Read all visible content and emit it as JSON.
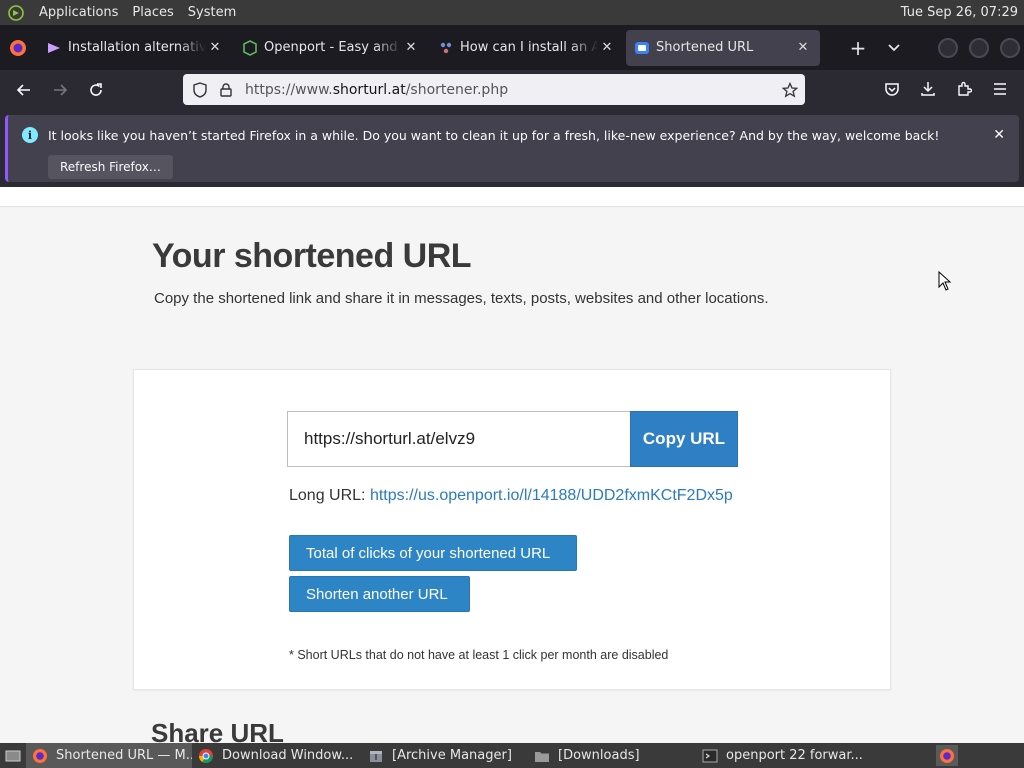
{
  "top_panel": {
    "menus": [
      "Applications",
      "Places",
      "System"
    ],
    "clock": "Tue Sep 26, 07:29"
  },
  "tabs": [
    {
      "title": "Installation alternatives",
      "active": false
    },
    {
      "title": "Openport - Easy and se",
      "active": false
    },
    {
      "title": "How can I install an Arc",
      "active": false
    },
    {
      "title": "Shortened URL",
      "active": true
    }
  ],
  "navbar": {
    "url_prefix": "https://www.",
    "url_host": "shorturl.at",
    "url_path": "/shortener.php"
  },
  "notification": {
    "message": "It looks like you haven’t started Firefox in a while. Do you want to clean it up for a fresh, like-new experience? And by the way, welcome back!",
    "refresh_label": "Refresh Firefox…"
  },
  "page": {
    "title": "Your shortened URL",
    "subtitle": "Copy the shortened link and share it in messages, texts, posts, websites and other locations.",
    "short_url": "https://shorturl.at/elvz9",
    "copy_label": "Copy URL",
    "long_url_label": "Long URL:",
    "long_url": "https://us.openport.io/l/14188/UDD2fxmKCtF2Dx5p",
    "clicks_label": "Total of clicks of your shortened URL",
    "another_label": "Shorten another URL",
    "footnote": "* Short URLs that do not have at least 1 click per month are disabled",
    "share_heading": "Share URL"
  },
  "taskbar": {
    "tasks": [
      {
        "label": "Shortened URL — M...",
        "icon": "firefox-icon",
        "active": true
      },
      {
        "label": "Download Window...",
        "icon": "chrome-icon",
        "active": false
      },
      {
        "label": "[Archive Manager]",
        "icon": "archive-icon",
        "active": false
      },
      {
        "label": "[Downloads]",
        "icon": "folder-icon",
        "active": false
      },
      {
        "label": "openport 22 forwar...",
        "icon": "terminal-icon",
        "active": false
      }
    ]
  },
  "colors": {
    "accent_blue": "#2e85c6",
    "link": "#2a7bc1",
    "notification_accent": "#9059ff"
  }
}
